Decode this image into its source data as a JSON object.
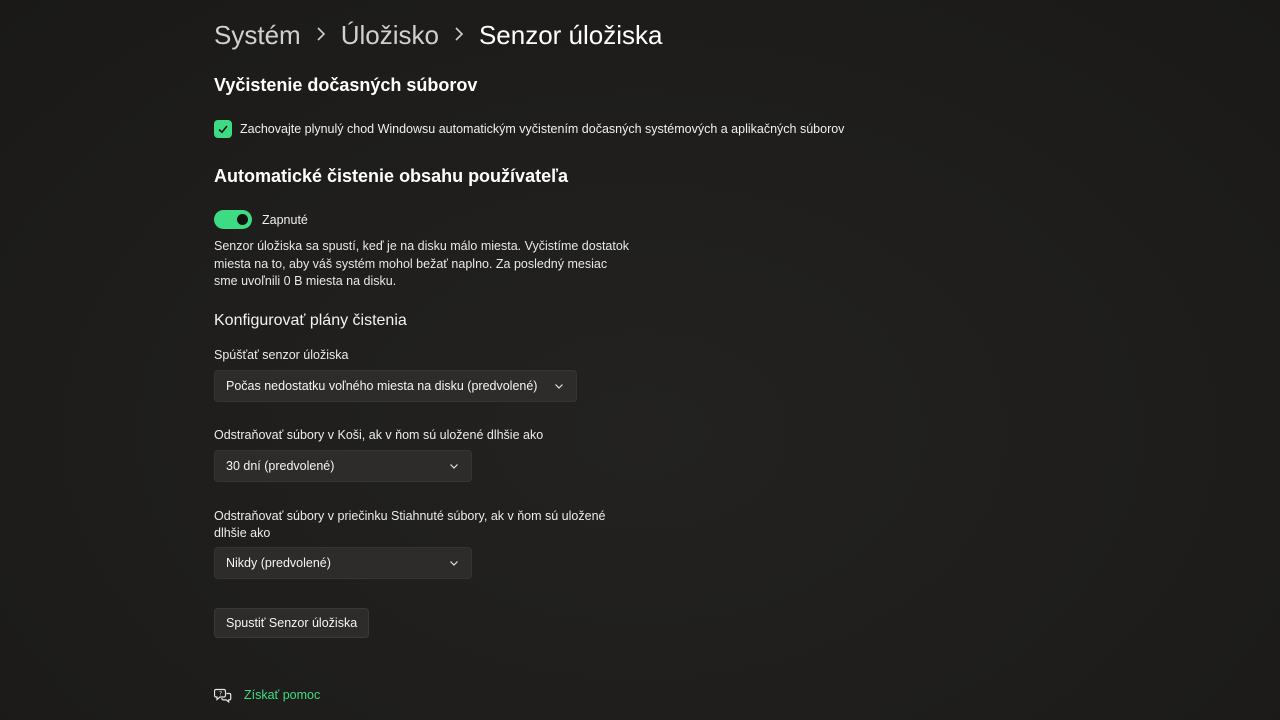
{
  "breadcrumb": {
    "items": [
      "Systém",
      "Úložisko",
      "Senzor úložiska"
    ],
    "separator_icon": "chevron-right-icon"
  },
  "temp_cleanup": {
    "heading": "Vyčistenie dočasných súborov",
    "checkbox_label": "Zachovajte plynulý chod Windowsu automatickým vyčistením dočasných systémových a aplikačných súborov",
    "checked": true
  },
  "auto_cleanup": {
    "heading": "Automatické čistenie obsahu používateľa",
    "toggle_label": "Zapnuté",
    "toggle_on": true,
    "description": "Senzor úložiska sa spustí, keď je na disku málo miesta. Vyčistíme dostatok miesta na to, aby váš systém mohol bežať naplno. Za posledný mesiac sme uvoľnili 0 B miesta na disku."
  },
  "schedules": {
    "heading": "Konfigurovať plány čistenia",
    "run_label": "Spúšťať senzor úložiska",
    "run_value": "Počas nedostatku voľného miesta na disku (predvolené)",
    "recycle_label": "Odstraňovať súbory v Koši, ak v ňom sú uložené dlhšie ako",
    "recycle_value": "30 dní (predvolené)",
    "downloads_label": "Odstraňovať súbory v priečinku Stiahnuté súbory, ak v ňom sú uložené dlhšie ako",
    "downloads_value": "Nikdy (predvolené)"
  },
  "actions": {
    "run_now_label": "Spustiť Senzor úložiska"
  },
  "help": {
    "label": "Získať pomoc",
    "icon": "help-chat-icon"
  },
  "colors": {
    "accent": "#3ddc84",
    "background": "#1f1e1c",
    "control": "#2d2c2a"
  }
}
